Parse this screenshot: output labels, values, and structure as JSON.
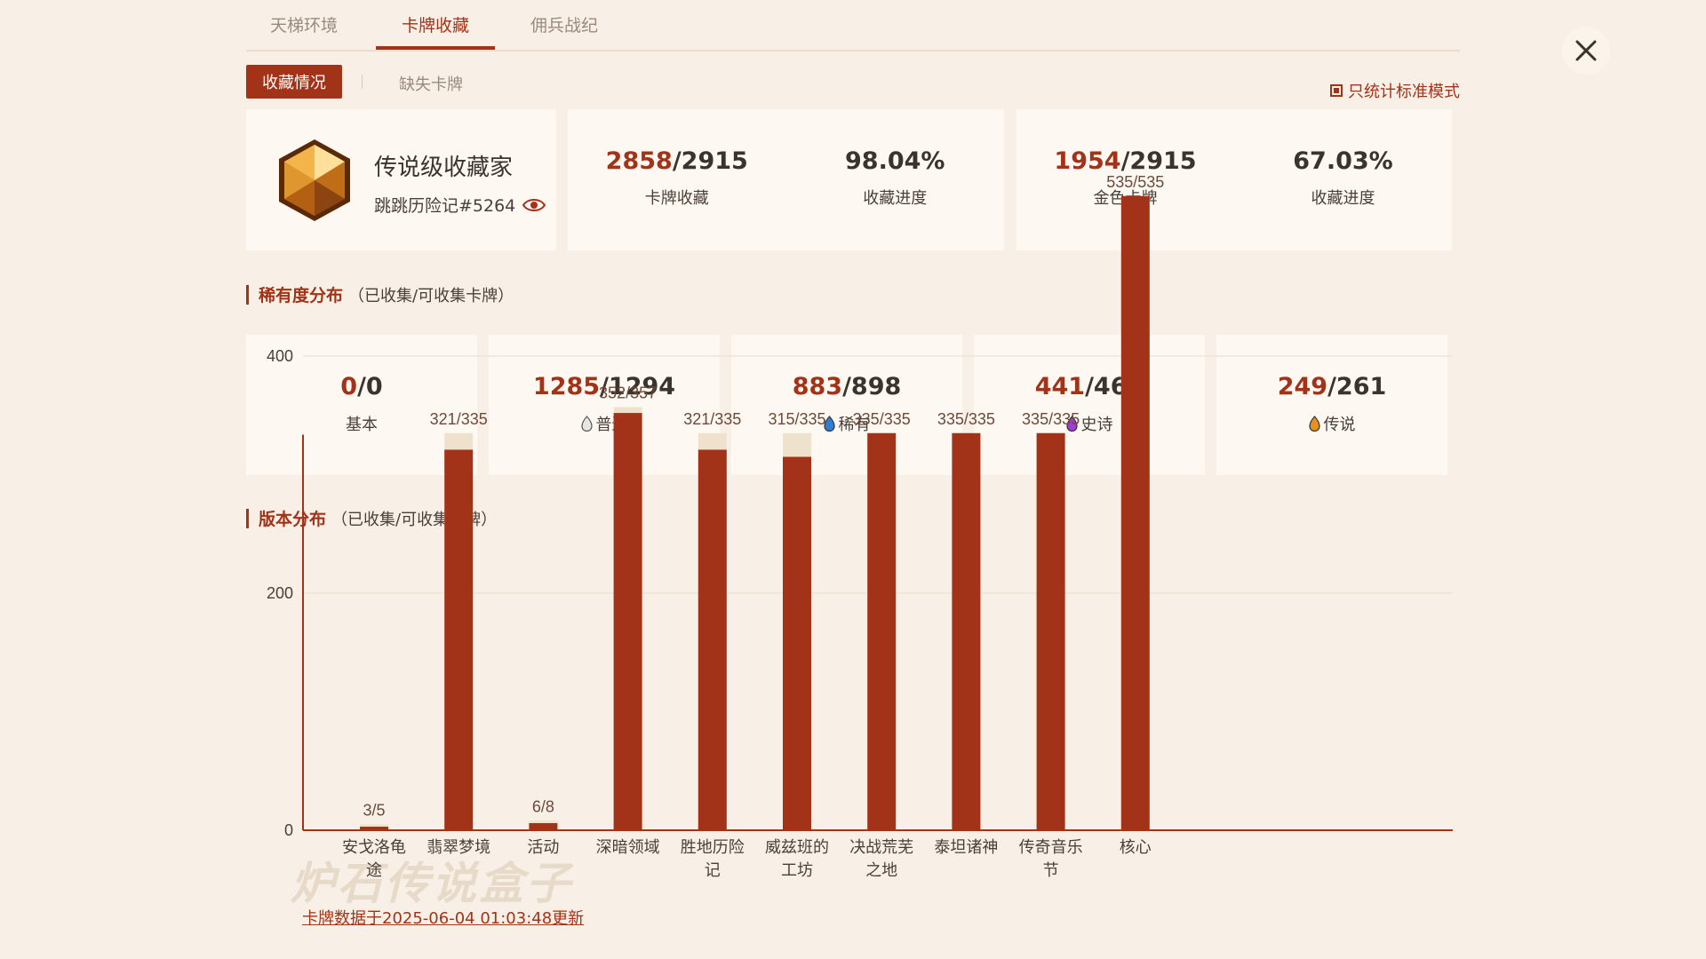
{
  "tabs": [
    "天梯环境",
    "卡牌收藏",
    "佣兵战纪"
  ],
  "subtabs": {
    "active": "收藏情况",
    "other": "缺失卡牌"
  },
  "std_mode_label": "只统计标准模式",
  "profile": {
    "title": "传说级收藏家",
    "name": "跳跳历险记#5264"
  },
  "collection": {
    "owned": "2858",
    "total": "/2915",
    "label": "卡牌收藏",
    "pct": "98.04%",
    "pct_label": "收藏进度"
  },
  "golden": {
    "owned": "1954",
    "total": "/2915",
    "label": "金色卡牌",
    "pct": "67.03%",
    "pct_label": "收藏进度"
  },
  "rarity_section": {
    "title": "稀有度分布",
    "subtitle": "（已收集/可收集卡牌）"
  },
  "rarity": [
    {
      "owned": "0",
      "total": "/0",
      "label": "基本",
      "color": ""
    },
    {
      "owned": "1285",
      "total": "/1294",
      "label": "普通",
      "color": "#d9d9d9"
    },
    {
      "owned": "883",
      "total": "/898",
      "label": "稀有",
      "color": "#2f7fd6"
    },
    {
      "owned": "441",
      "total": "/462",
      "label": "史诗",
      "color": "#a43bd6"
    },
    {
      "owned": "249",
      "total": "/261",
      "label": "传说",
      "color": "#e8901c"
    }
  ],
  "version_section": {
    "title": "版本分布",
    "subtitle": "（已收集/可收集卡牌）"
  },
  "chart_data": {
    "type": "bar",
    "categories": [
      "安戈洛龟途",
      "翡翠梦境",
      "活动",
      "深暗领域",
      "胜地历险记",
      "威兹班的工坊",
      "决战荒芜之地",
      "泰坦诸神",
      "传奇音乐节",
      "核心"
    ],
    "category_lines": [
      [
        "安戈洛龟",
        "途"
      ],
      [
        "翡翠梦境"
      ],
      [
        "活动"
      ],
      [
        "深暗领域"
      ],
      [
        "胜地历险",
        "记"
      ],
      [
        "威兹班的",
        "工坊"
      ],
      [
        "决战荒芜",
        "之地"
      ],
      [
        "泰坦诸神"
      ],
      [
        "传奇音乐",
        "节"
      ],
      [
        "核心"
      ]
    ],
    "series": [
      {
        "name": "collected",
        "values": [
          3,
          321,
          6,
          352,
          321,
          315,
          335,
          335,
          335,
          535
        ]
      },
      {
        "name": "total",
        "values": [
          5,
          335,
          8,
          357,
          335,
          335,
          335,
          335,
          335,
          535
        ]
      }
    ],
    "data_labels": [
      "3/5",
      "321/335",
      "6/8",
      "352/357",
      "321/335",
      "315/335",
      "335/335",
      "335/335",
      "335/335",
      "535/535"
    ],
    "yticks": [
      0,
      200,
      400
    ],
    "ylim": [
      0,
      535
    ],
    "grid": true
  },
  "colors": {
    "accent": "#a23318",
    "track": "#efe2cd"
  },
  "footer": {
    "update": "卡牌数据于2025-06-04 01:03:48更新",
    "watermark": "炉石传说盒子"
  }
}
